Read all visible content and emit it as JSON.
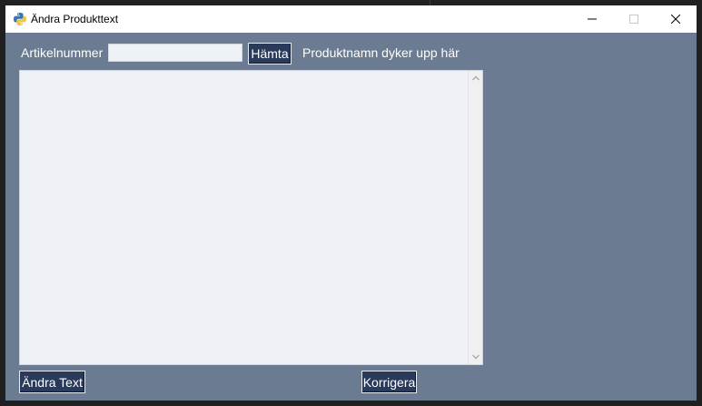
{
  "window": {
    "title": "Ändra Produkttext",
    "icon": "python-icon",
    "controls": {
      "minimize": "minimize-icon",
      "maximize": "maximize-icon",
      "close": "close-icon"
    }
  },
  "form": {
    "article_label": "Artikelnummer",
    "article_value": "",
    "article_placeholder": "",
    "fetch_button": "Hämta",
    "product_name": "Produktnamn dyker upp här",
    "text_value": ""
  },
  "footer": {
    "change_button": "Ändra Text",
    "correct_button": "Korrigera"
  },
  "colors": {
    "window_bg": "#6b7b92",
    "button_bg": "#2a3a5a",
    "field_bg": "#eef1f6",
    "titlebar_bg": "#ffffff"
  }
}
